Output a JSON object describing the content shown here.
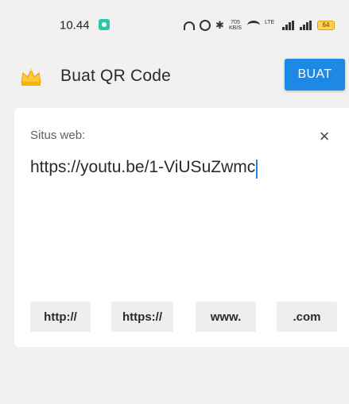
{
  "status_bar": {
    "time": "10.44",
    "net_speed_value": "705",
    "net_speed_unit": "KB/S",
    "network_type": "LTE",
    "battery": "64"
  },
  "app_bar": {
    "title": "Buat QR Code",
    "create_label": "BUAT",
    "logo_icon": "crown-icon"
  },
  "form": {
    "label": "Situs web:",
    "url_value": "https://youtu.be/1-ViUSuZwmc",
    "clear_icon": "close-icon"
  },
  "chips": [
    {
      "label": "http://"
    },
    {
      "label": "https://"
    },
    {
      "label": "www."
    },
    {
      "label": ".com"
    }
  ],
  "colors": {
    "accent": "#1e88e5",
    "background": "#f1f1f1",
    "card": "#ffffff",
    "chip": "#eeeeee"
  }
}
